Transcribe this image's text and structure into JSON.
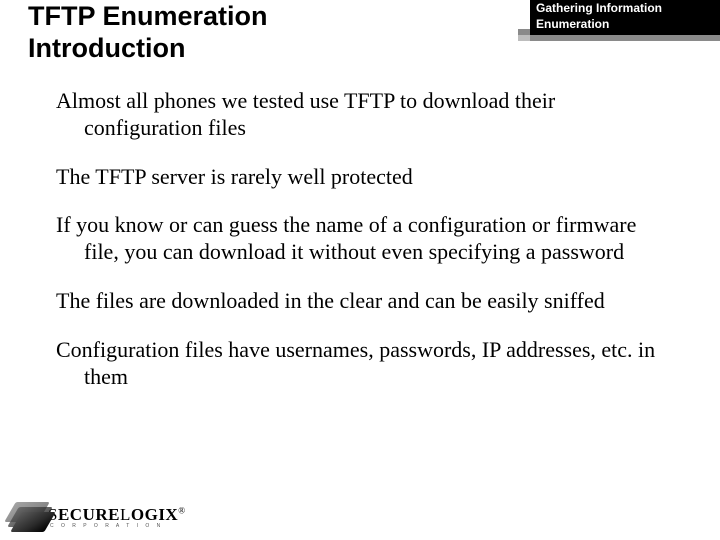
{
  "header": {
    "title_line1": "TFTP Enumeration",
    "title_line2": "Introduction",
    "tag_line1": "Gathering Information",
    "tag_line2": "Enumeration"
  },
  "bullets": [
    "Almost all phones we tested use TFTP to download their configuration files",
    "The TFTP server is rarely well protected",
    "If you know or can guess the name of a configuration or firmware file, you can download it without even specifying a password",
    "The files are downloaded in the clear and can be easily sniffed",
    "Configuration files have usernames, passwords, IP addresses, etc. in them"
  ],
  "logo": {
    "part1": "S",
    "part2": "ECURE",
    "part3": "L",
    "part4": "OGIX",
    "reg": "®",
    "sub": "C O R P O R A T I O N"
  }
}
